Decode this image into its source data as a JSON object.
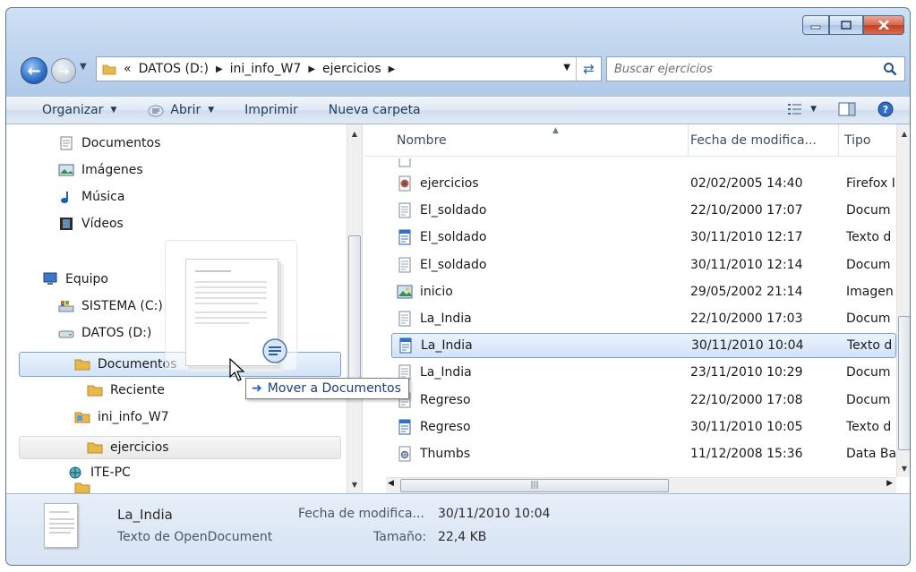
{
  "window": {
    "minimize_icon": "minimize-icon",
    "maximize_icon": "maximize-icon",
    "close_icon": "close-icon"
  },
  "address": {
    "overflow": "«",
    "crumbs": [
      "DATOS (D:)",
      "ini_info_W7",
      "ejercicios"
    ],
    "search_placeholder": "Buscar ejercicios"
  },
  "toolbar": {
    "organize": "Organizar",
    "open": "Abrir",
    "print": "Imprimir",
    "new_folder": "Nueva carpeta"
  },
  "nav": {
    "items": [
      {
        "label": "Documentos",
        "icon": "documents-icon"
      },
      {
        "label": "Imágenes",
        "icon": "pictures-icon"
      },
      {
        "label": "Música",
        "icon": "music-icon"
      },
      {
        "label": "Vídeos",
        "icon": "videos-icon"
      },
      {
        "label": "Equipo",
        "icon": "computer-icon"
      },
      {
        "label": "SISTEMA (C:)",
        "icon": "system-drive-icon"
      },
      {
        "label": "DATOS (D:)",
        "icon": "drive-icon"
      },
      {
        "label": "Documentos",
        "icon": "folder-icon"
      },
      {
        "label": "Reciente",
        "icon": "folder-icon"
      },
      {
        "label": "ini_info_W7",
        "icon": "folder-icon"
      },
      {
        "label": "ejercicios",
        "icon": "folder-icon"
      },
      {
        "label": "ITE-PC",
        "icon": "network-icon"
      }
    ]
  },
  "columns": {
    "name": "Nombre",
    "date": "Fecha de modifica...",
    "type": "Tipo"
  },
  "files": [
    {
      "name": "ejercicios",
      "date": "02/02/2005 14:40",
      "type": "Firefox I",
      "icon": "firefox-html-icon"
    },
    {
      "name": "El_soldado",
      "date": "22/10/2000 17:07",
      "type": "Docum",
      "icon": "document-icon"
    },
    {
      "name": "El_soldado",
      "date": "30/11/2010 12:17",
      "type": "Texto d",
      "icon": "opendocument-text-icon"
    },
    {
      "name": "El_soldado",
      "date": "30/11/2010 12:14",
      "type": "Docum",
      "icon": "document-icon"
    },
    {
      "name": "inicio",
      "date": "29/05/2002 21:14",
      "type": "Imagen",
      "icon": "image-file-icon"
    },
    {
      "name": "La_India",
      "date": "22/10/2000 17:03",
      "type": "Docum",
      "icon": "document-icon"
    },
    {
      "name": "La_India",
      "date": "30/11/2010 10:04",
      "type": "Texto d",
      "icon": "opendocument-text-icon"
    },
    {
      "name": "La_India",
      "date": "23/11/2010 10:29",
      "type": "Docum",
      "icon": "document-icon"
    },
    {
      "name": "Regreso",
      "date": "22/10/2000 17:08",
      "type": "Docum",
      "icon": "document-icon"
    },
    {
      "name": "Regreso",
      "date": "30/11/2010 10:05",
      "type": "Texto d",
      "icon": "opendocument-text-icon"
    },
    {
      "name": "Thumbs",
      "date": "11/12/2008 15:36",
      "type": "Data Ba",
      "icon": "database-file-icon"
    }
  ],
  "drag": {
    "tooltip": "Mover a Documentos"
  },
  "details": {
    "name": "La_India",
    "type": "Texto de OpenDocument",
    "date_label": "Fecha de modifica...",
    "date_value": "30/11/2010 10:04",
    "size_label": "Tamaño:",
    "size_value": "22,4 KB"
  }
}
